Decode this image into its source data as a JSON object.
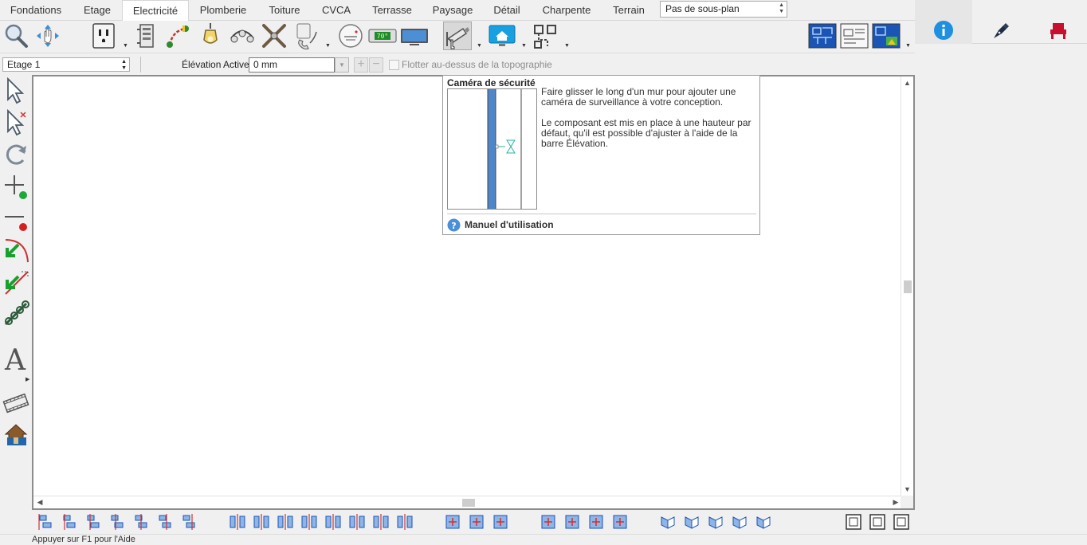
{
  "tabs": [
    {
      "label": "Fondations",
      "active": false
    },
    {
      "label": "Etage",
      "active": false
    },
    {
      "label": "Electricité",
      "active": true
    },
    {
      "label": "Plomberie",
      "active": false
    },
    {
      "label": "Toiture",
      "active": false
    },
    {
      "label": "CVCA",
      "active": false
    },
    {
      "label": "Terrasse",
      "active": false
    },
    {
      "label": "Paysage",
      "active": false
    },
    {
      "label": "Détail",
      "active": false
    },
    {
      "label": "Charpente",
      "active": false
    },
    {
      "label": "Terrain",
      "active": false
    }
  ],
  "subplan": {
    "value": "Pas de sous-plan"
  },
  "right_panel": {
    "tabs": [
      {
        "icon": "info-icon",
        "selected": true
      },
      {
        "icon": "pen-nib-icon",
        "selected": false
      },
      {
        "icon": "armchair-icon",
        "selected": false
      }
    ]
  },
  "toolbar": {
    "thermostat_readout": "70°",
    "tools": [
      {
        "icon": "zoom-icon"
      },
      {
        "icon": "pan-icon"
      },
      {
        "icon": "outlet-icon"
      },
      {
        "icon": "electrical-panel-icon"
      },
      {
        "icon": "wire-icon"
      },
      {
        "icon": "pendant-light-icon"
      },
      {
        "icon": "track-light-icon"
      },
      {
        "icon": "ceiling-fan-icon"
      },
      {
        "icon": "phone-icon"
      },
      {
        "icon": "smoke-detector-icon"
      },
      {
        "icon": "thermostat-icon"
      },
      {
        "icon": "tv-icon"
      },
      {
        "icon": "security-camera-icon",
        "pressed": true
      },
      {
        "icon": "home-monitor-icon"
      },
      {
        "icon": "connection-icon"
      },
      {
        "icon": "floor-plan-view-icon"
      },
      {
        "icon": "elevation-view-icon"
      },
      {
        "icon": "site-plan-view-icon"
      }
    ]
  },
  "elevation_bar": {
    "floor": "Etage 1",
    "elevation_label": "Élévation Active:",
    "elevation_value": "0 mm",
    "float_label": "Flotter au-dessus de la topographie",
    "float_checked": false
  },
  "left_tools": [
    {
      "icon": "select-arrow-icon"
    },
    {
      "icon": "select-multiple-icon"
    },
    {
      "icon": "rotate-icon"
    },
    {
      "icon": "add-point-icon"
    },
    {
      "icon": "delete-point-icon"
    },
    {
      "icon": "arc-tool-icon"
    },
    {
      "icon": "line-tool-icon"
    },
    {
      "icon": "chain-icon"
    },
    {
      "icon": "text-tool-icon"
    },
    {
      "icon": "film-icon"
    },
    {
      "icon": "house-3d-icon"
    }
  ],
  "tooltip": {
    "title": "Caméra de sécurité",
    "para1": "Faire glisser le long d'un mur pour ajouter une caméra de surveillance à votre conception.",
    "para2": "Le composant est mis en place à une hauteur par défaut, qu'il est possible d'ajuster à l'aide de la barre Élévation.",
    "help_label": "Manuel d'utilisation",
    "colors": {
      "wall": "#4f86c9",
      "camera": "#29b3a3"
    }
  },
  "bottom_tools": [
    {
      "icon": "align-left-icon"
    },
    {
      "icon": "align-center-h-icon"
    },
    {
      "icon": "align-right-icon"
    },
    {
      "icon": "align-center-icon"
    },
    {
      "icon": "align-top-icon"
    },
    {
      "icon": "align-middle-v-icon"
    },
    {
      "icon": "align-bottom-icon"
    },
    {
      "icon": "distribute-h-1-icon"
    },
    {
      "icon": "distribute-h-2-icon"
    },
    {
      "icon": "distribute-h-3-icon"
    },
    {
      "icon": "distribute-h-4-icon"
    },
    {
      "icon": "distribute-v-1-icon"
    },
    {
      "icon": "distribute-v-2-icon"
    },
    {
      "icon": "distribute-v-3-icon"
    },
    {
      "icon": "distribute-v-4-icon"
    },
    {
      "icon": "resize-w-icon"
    },
    {
      "icon": "resize-h-icon"
    },
    {
      "icon": "resize-both-icon"
    },
    {
      "icon": "stretch-v-icon"
    },
    {
      "icon": "center-in-box-icon"
    },
    {
      "icon": "center-point-icon"
    },
    {
      "icon": "shrink-icon"
    },
    {
      "icon": "copy-icon"
    },
    {
      "icon": "mirror-1-icon"
    },
    {
      "icon": "mirror-2-icon"
    },
    {
      "icon": "mirror-3-icon"
    },
    {
      "icon": "mirror-4-icon"
    },
    {
      "icon": "frame-1-icon"
    },
    {
      "icon": "frame-2-icon"
    },
    {
      "icon": "frame-3-icon"
    }
  ],
  "status": {
    "text": "Appuyer sur F1 pour l'Aide"
  }
}
